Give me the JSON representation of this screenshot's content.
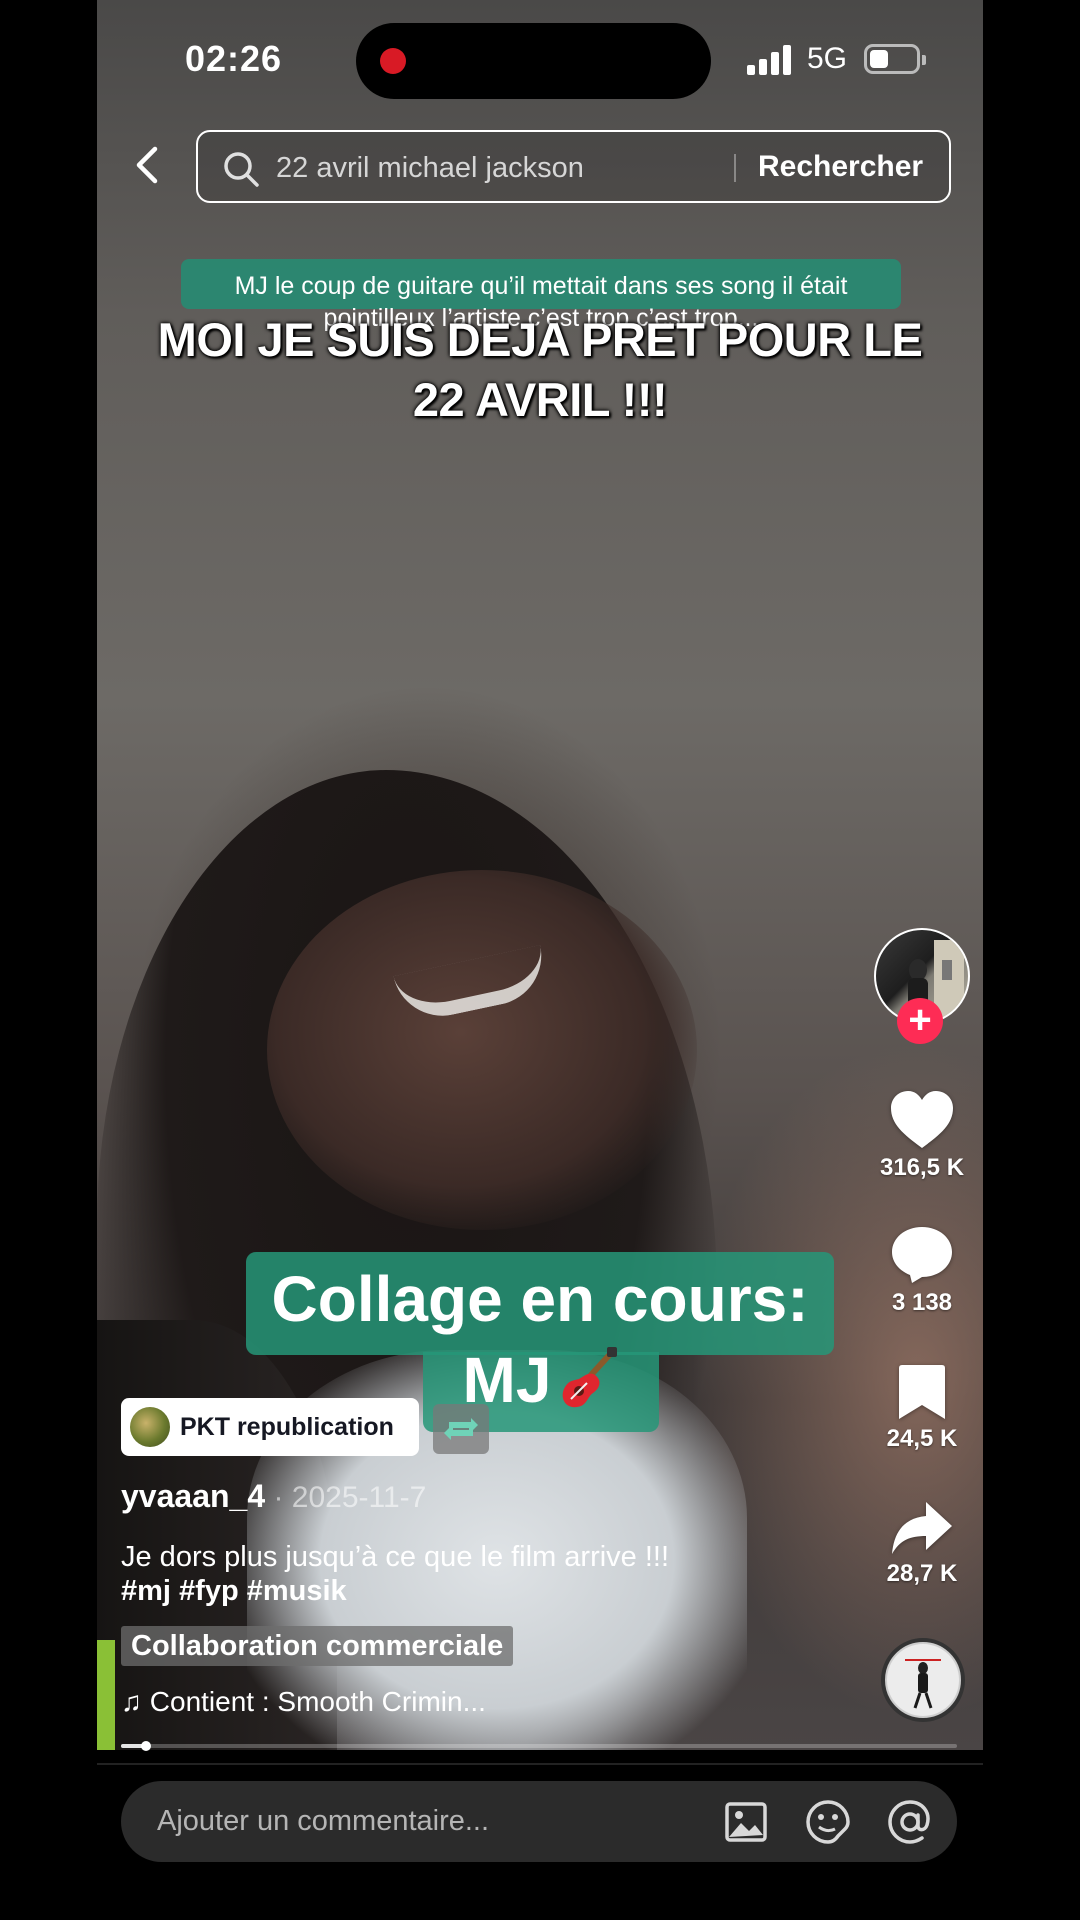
{
  "status_bar": {
    "time": "02:26",
    "network": "5G",
    "battery_percent": 30
  },
  "search": {
    "query": "22 avril michael jackson",
    "button_label": "Rechercher"
  },
  "video": {
    "banner_text": "MJ le coup de guitare qu’il mettait dans ses song il était pointilleux l’artiste c’est trop c’est trop...",
    "headline": "MOI JE SUIS DEJA PRET POUR LE 22 AVRIL !!!",
    "collage_line1": "Collage en cours:",
    "collage_line2": "MJ",
    "collage_emoji": "🎸"
  },
  "actions": {
    "likes": "316,5 K",
    "comments": "3 138",
    "saves": "24,5 K",
    "shares": "28,7 K",
    "follow_symbol": "+"
  },
  "post": {
    "repost_label": "PKT republication",
    "username": "yvaaan_4",
    "date": " · 2025-11-7",
    "caption": "Je dors plus jusqu’à ce que le film arrive !!!",
    "hashtags": "#mj #fyp #musik",
    "collab_label": "Collaboration commerciale",
    "music_note": "♫",
    "music": "Contient : Smooth Crimin..."
  },
  "progress": 0.03,
  "comment": {
    "placeholder": "Ajouter un commentaire..."
  },
  "icons": {
    "back": "chevron-left-icon",
    "search": "search-icon",
    "like": "heart-icon",
    "comment": "comment-icon",
    "save": "bookmark-icon",
    "share": "share-icon",
    "image": "image-icon",
    "emoji": "emoji-icon",
    "mention": "at-icon"
  },
  "colors": {
    "accent": "#fe2c55",
    "caption_green": "#26967a"
  }
}
